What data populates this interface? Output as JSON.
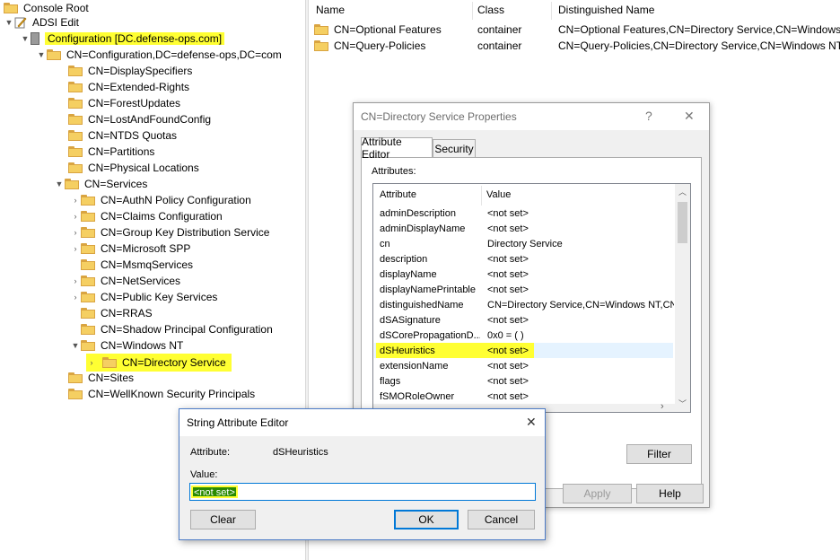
{
  "tree": {
    "console_root": "Console Root",
    "adsi_edit": "ADSI Edit",
    "configuration": "Configuration [DC.defense-ops.com]",
    "cn_configuration": "CN=Configuration,DC=defense-ops,DC=com",
    "children": [
      "CN=DisplaySpecifiers",
      "CN=Extended-Rights",
      "CN=ForestUpdates",
      "CN=LostAndFoundConfig",
      "CN=NTDS Quotas",
      "CN=Partitions",
      "CN=Physical Locations"
    ],
    "services": "CN=Services",
    "service_children": [
      "CN=AuthN Policy Configuration",
      "CN=Claims Configuration",
      "CN=Group Key Distribution Service",
      "CN=Microsoft SPP",
      "CN=MsmqServices",
      "CN=NetServices",
      "CN=Public Key Services",
      "CN=RRAS",
      "CN=Shadow Principal Configuration"
    ],
    "windows_nt": "CN=Windows NT",
    "directory_service": "CN=Directory Service",
    "sites": "CN=Sites",
    "wellknown": "CN=WellKnown Security Principals"
  },
  "list": {
    "headers": {
      "name": "Name",
      "class": "Class",
      "dn": "Distinguished Name"
    },
    "rows": [
      {
        "name": "CN=Optional Features",
        "class": "container",
        "dn": "CN=Optional Features,CN=Directory Service,CN=Windows"
      },
      {
        "name": "CN=Query-Policies",
        "class": "container",
        "dn": "CN=Query-Policies,CN=Directory Service,CN=Windows NT"
      }
    ]
  },
  "props_dialog": {
    "title": "CN=Directory Service Properties",
    "help_glyph": "?",
    "close_glyph": "✕",
    "tabs": [
      "Attribute Editor",
      "Security"
    ],
    "attributes_label": "Attributes:",
    "col_attribute": "Attribute",
    "col_value": "Value",
    "rows": [
      {
        "attr": "adminDescription",
        "value": "<not set>"
      },
      {
        "attr": "adminDisplayName",
        "value": "<not set>"
      },
      {
        "attr": "cn",
        "value": "Directory Service"
      },
      {
        "attr": "description",
        "value": "<not set>"
      },
      {
        "attr": "displayName",
        "value": "<not set>"
      },
      {
        "attr": "displayNamePrintable",
        "value": "<not set>"
      },
      {
        "attr": "distinguishedName",
        "value": "CN=Directory Service,CN=Windows NT,CN="
      },
      {
        "attr": "dSASignature",
        "value": "<not set>"
      },
      {
        "attr": "dSCorePropagationD...",
        "value": "0x0 = ( )"
      },
      {
        "attr": "dSHeuristics",
        "value": "<not set>"
      },
      {
        "attr": "extensionName",
        "value": "<not set>"
      },
      {
        "attr": "flags",
        "value": "<not set>"
      },
      {
        "attr": "fSMORoleOwner",
        "value": "<not set>"
      }
    ],
    "filter_label": "Filter",
    "apply_label": "Apply",
    "help_label": "Help"
  },
  "string_editor": {
    "title": "String Attribute Editor",
    "close_glyph": "✕",
    "attribute_label": "Attribute:",
    "attribute_value": "dSHeuristics",
    "value_label": "Value:",
    "value": "<not set>",
    "clear_label": "Clear",
    "ok_label": "OK",
    "cancel_label": "Cancel"
  },
  "colors": {
    "highlight": "#ffff33",
    "selection": "#cce8ff",
    "dialog_bg": "#f0f0f0",
    "accent_border": "#0078d7"
  }
}
